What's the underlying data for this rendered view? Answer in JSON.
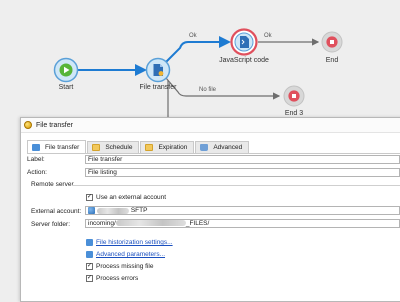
{
  "workflow": {
    "nodes": {
      "start": "Start",
      "file_transfer": "File transfer",
      "javascript": "JavaScript code",
      "end": "End",
      "end3": "End 3"
    },
    "transitions": {
      "ok1": "Ok",
      "ok2": "Ok",
      "no_file": "No file"
    }
  },
  "dialog": {
    "title": "File transfer",
    "tabs": [
      "File transfer",
      "Schedule",
      "Expiration",
      "Advanced"
    ],
    "label_caption": "Label:",
    "label_value": "File transfer",
    "action_caption": "Action:",
    "action_value": "File listing",
    "section_remote": "Remote server",
    "use_external": "Use an external account",
    "external_account_caption": "External account:",
    "external_account_value": "SFTP",
    "server_folder_caption": "Server folder:",
    "server_folder_prefix": "incoming/",
    "server_folder_suffix": "_FILES/",
    "history_link": "File historization settings...",
    "advanced_link": "Advanced parameters...",
    "process_missing": "Process missing file",
    "process_errors": "Process errors"
  },
  "colors": {
    "accent": "#1e7bd2",
    "start_green": "#57b538",
    "end_red": "#e0505d"
  }
}
